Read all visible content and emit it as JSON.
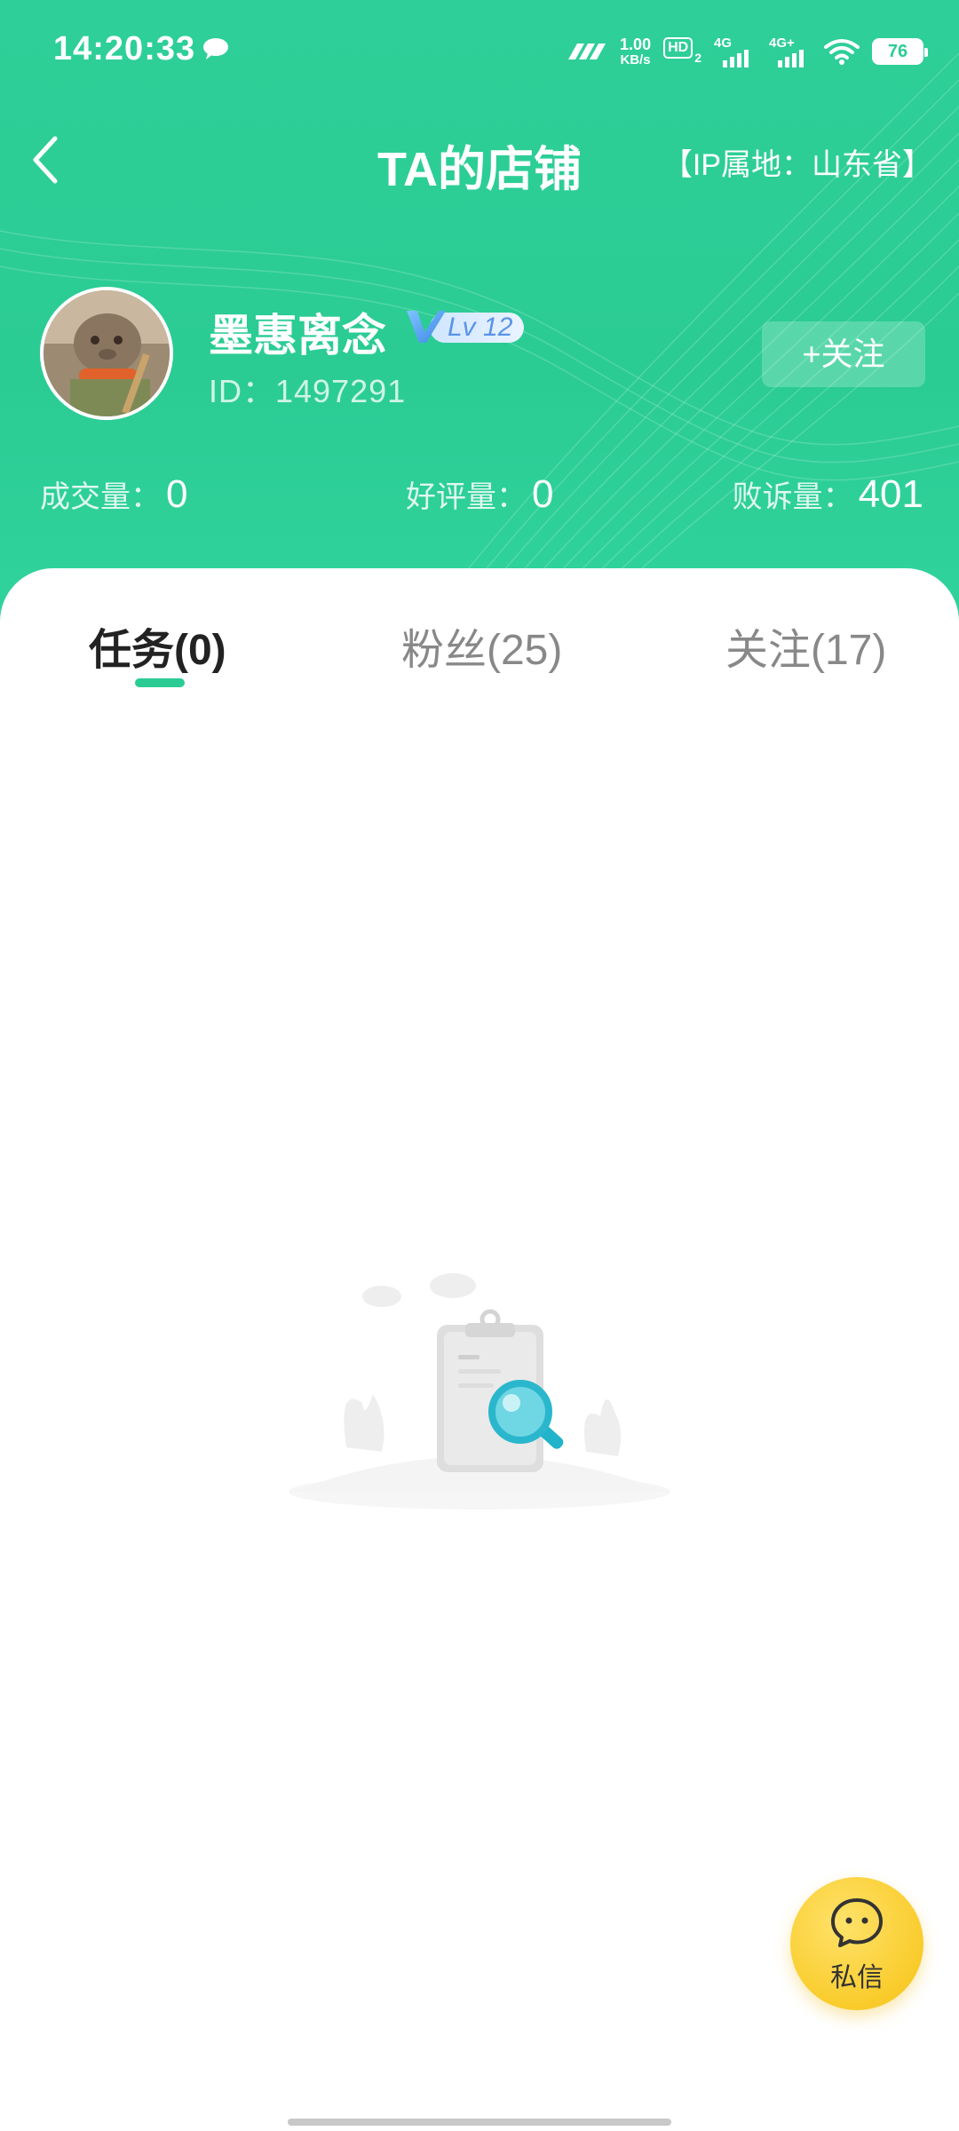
{
  "status_bar": {
    "time": "14:20:33",
    "net_speed_value": "1.00",
    "net_speed_unit": "KB/s",
    "hd_label": "HD",
    "hd_sub": "2",
    "sig1_label": "4G",
    "sig2_label": "4G+",
    "battery": "76"
  },
  "nav": {
    "title": "TA的店铺",
    "ip_location": "【IP属地：山东省】"
  },
  "profile": {
    "name": "墨惠离念",
    "level": "Lv 12",
    "id_text": "ID：1497291",
    "follow_label": "+关注"
  },
  "stats": {
    "deals_label": "成交量：",
    "deals_value": "0",
    "good_label": "好评量：",
    "good_value": "0",
    "complaints_label": "败诉量：",
    "complaints_value": "401"
  },
  "tabs": [
    {
      "label": "任务(0)",
      "active": true
    },
    {
      "label": "粉丝(25)",
      "active": false
    },
    {
      "label": "关注(17)",
      "active": false
    }
  ],
  "fab": {
    "label": "私信"
  },
  "colors": {
    "primary_green": "#2bcc94",
    "fab_yellow": "#f9cc2c"
  }
}
